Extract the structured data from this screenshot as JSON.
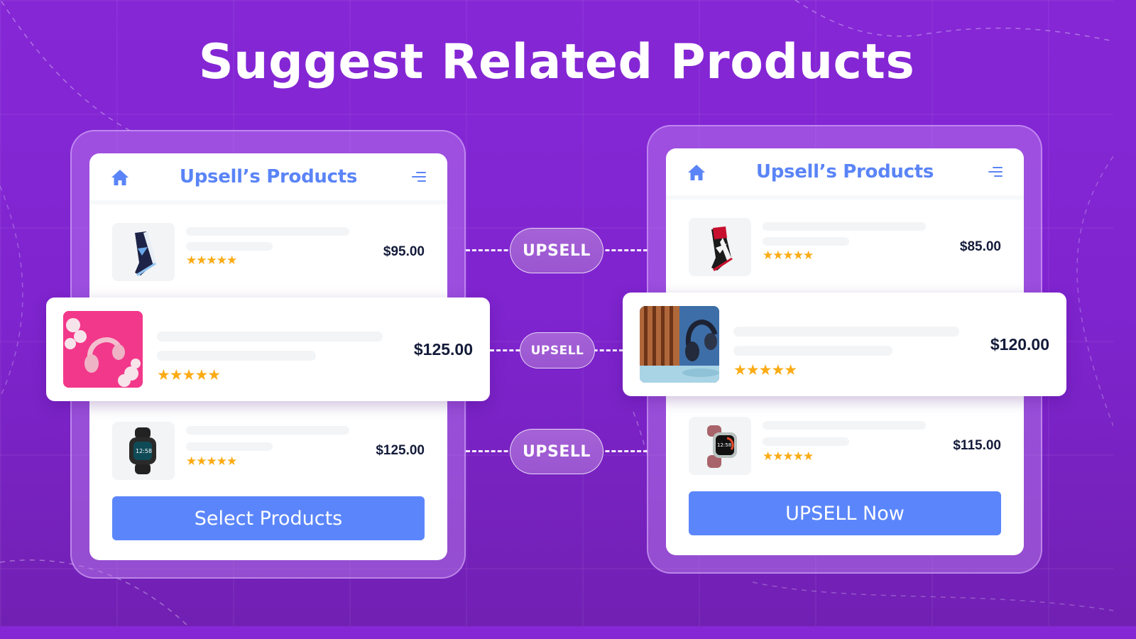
{
  "page": {
    "title": "Suggest Related Products",
    "background_color": "#8627d6"
  },
  "colors": {
    "accent_blue": "#5b86fb",
    "title_blue": "#5a84f7",
    "star_gold": "#fbab15",
    "price_text": "#141b3a"
  },
  "left_panel": {
    "title": "Upsell’s Products",
    "home_icon": "home-icon",
    "menu_icon": "menu-icon",
    "products": [
      {
        "image": "blue-sneaker",
        "rating": 5,
        "stars": "★★★★★",
        "price": "$95.00"
      },
      {
        "image": "pink-headphones",
        "rating": 5,
        "stars": "★★★★★",
        "price": "$125.00",
        "highlighted": true
      },
      {
        "image": "black-smartwatch",
        "rating": 5,
        "stars": "★★★★★",
        "price": "$125.00"
      }
    ],
    "button_label": "Select Products"
  },
  "connectors": [
    {
      "label": "UPSELL"
    },
    {
      "label": "UPSELL"
    },
    {
      "label": "UPSELL"
    }
  ],
  "right_panel": {
    "title": "Upsell’s Products",
    "home_icon": "home-icon",
    "menu_icon": "menu-icon",
    "products": [
      {
        "image": "red-sneaker",
        "rating": 5,
        "stars": "★★★★★",
        "price": "$85.00"
      },
      {
        "image": "dark-headphones",
        "rating": 5,
        "stars": "★★★★★",
        "price": "$120.00",
        "highlighted": true
      },
      {
        "image": "rose-smartwatch",
        "rating": 5,
        "stars": "★★★★★",
        "price": "$115.00"
      }
    ],
    "button_label": "UPSELL Now"
  }
}
